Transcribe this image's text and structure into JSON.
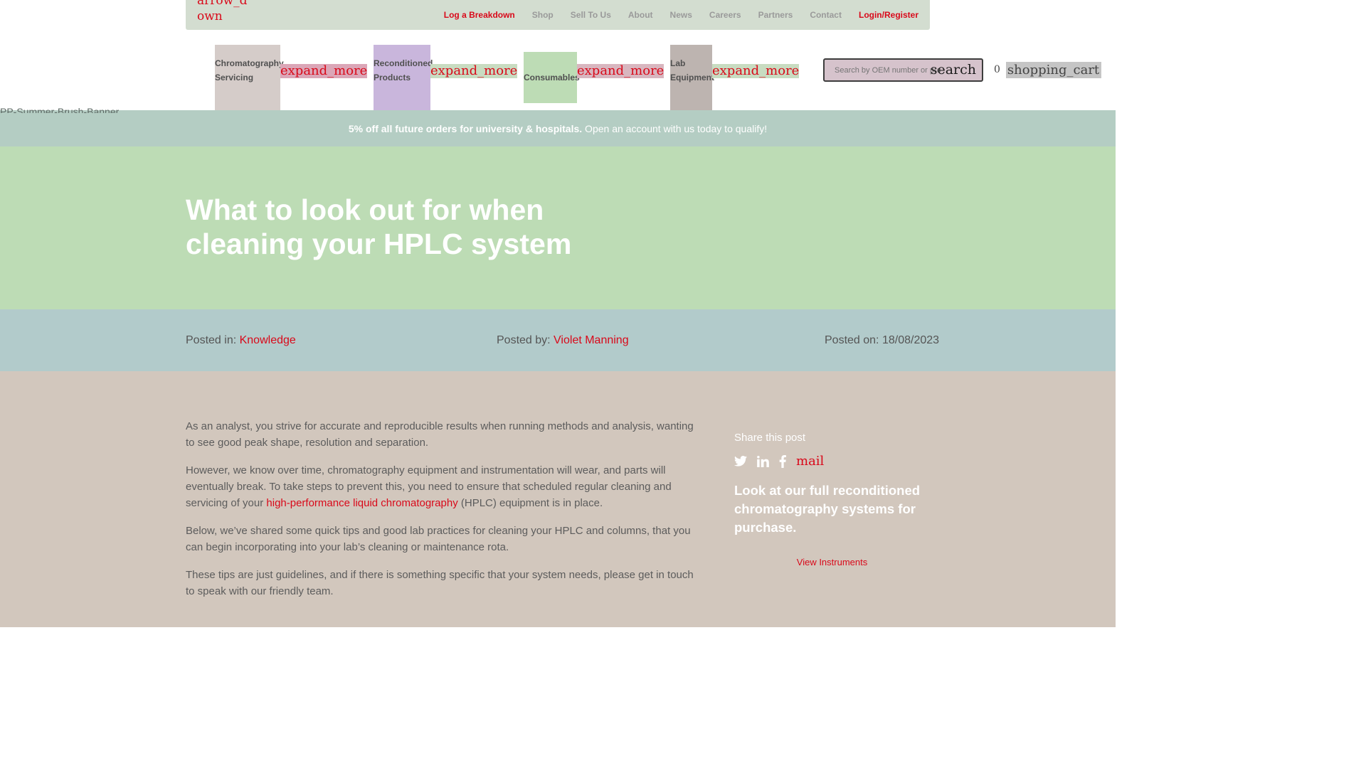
{
  "topbar": {
    "lang_icon": "arrow_down",
    "lang_text": "arrow_down",
    "nav": [
      {
        "label": "Log a Breakdown",
        "highlight": true
      },
      {
        "label": "Shop",
        "highlight": false
      },
      {
        "label": "Sell To Us",
        "highlight": false
      },
      {
        "label": "About",
        "highlight": false
      },
      {
        "label": "News",
        "highlight": false
      },
      {
        "label": "Careers",
        "highlight": false
      },
      {
        "label": "Partners",
        "highlight": false
      },
      {
        "label": "Contact",
        "highlight": false
      },
      {
        "label": "Login/Register",
        "highlight": true
      }
    ]
  },
  "mainnav": {
    "items": [
      {
        "label": "Chromatography Servicing",
        "caret": "expand_more"
      },
      {
        "label": "Reconditioned Products",
        "caret": "expand_more"
      },
      {
        "label": "Consumables",
        "caret": "expand_more"
      },
      {
        "label": "Lab Equipment",
        "caret": "expand_more"
      }
    ],
    "search_placeholder": "Search by OEM number or product",
    "search_icon": "search",
    "cart_count": "0",
    "cart_icon": "shopping_cart"
  },
  "promo": {
    "image_alt": "PP-Summer-Brush-Banner",
    "bold": "5% off all future orders for university & hospitals.",
    "text": " Open an account with us today to qualify!"
  },
  "hero": {
    "title": "What to look out for when cleaning your HPLC system"
  },
  "meta": {
    "posted_in_label": "Posted in: ",
    "posted_in": "Knowledge",
    "posted_by_label": "Posted by: ",
    "posted_by": "Violet Manning",
    "posted_on_label": "Posted on: ",
    "posted_on": "18/08/2023"
  },
  "article": {
    "p1": "As an analyst, you strive for accurate and reproducible results when running methods and analysis, wanting to see good peak shape, resolution and separation.",
    "p2_before": "However, we know over time, chromatography equipment and instrumentation will wear, and parts will eventually break. To take steps to prevent this, you need to ensure that scheduled regular cleaning and servicing of your ",
    "p2_link": "high-performance liquid chromatography",
    "p2_after": " (HPLC) equipment is in place.",
    "p3": "Below, we’ve shared some quick tips and good lab practices for cleaning your HPLC and columns, that you can begin incorporating into your lab’s cleaning or maintenance rota.",
    "p4": "These tips are just guidelines, and if there is something specific that your system needs, please get in touch to speak with our friendly team."
  },
  "sidebar": {
    "share_title": "Share this post",
    "mail_icon": "mail",
    "cta": "Look at our full reconditioned chromatography systems for purchase.",
    "button": "View Instruments"
  }
}
